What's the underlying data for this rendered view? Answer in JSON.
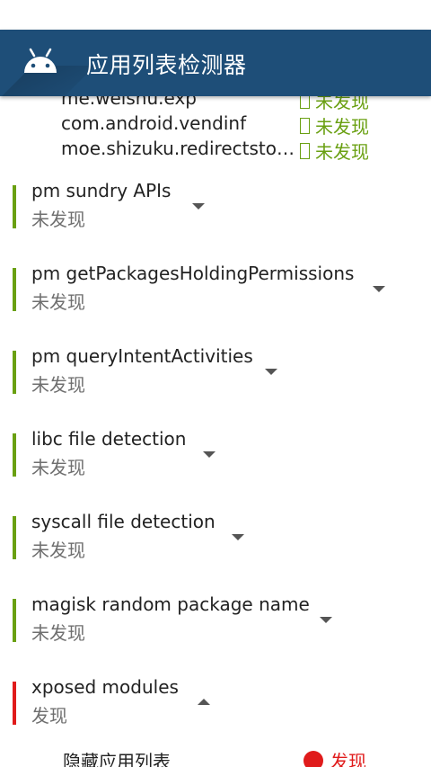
{
  "app": {
    "title": "应用列表检测器",
    "logo_icon": "android-icon",
    "colors": {
      "primary": "#1e4e78",
      "ok": "#6aa012",
      "bad": "#e01b1b"
    }
  },
  "packages": [
    {
      "name": "me.weishu.exp",
      "status": "未发现"
    },
    {
      "name": "com.android.vendinf",
      "status": "未发现"
    },
    {
      "name": "moe.shizuku.redirectstorage",
      "status": "未发现"
    }
  ],
  "checks": [
    {
      "name": "pm sundry APIs",
      "status": "未发现",
      "expanded": false
    },
    {
      "name": "pm getPackagesHoldingPermissions",
      "status": "未发现",
      "expanded": false
    },
    {
      "name": "pm queryIntentActivities",
      "status": "未发现",
      "expanded": false
    },
    {
      "name": "libc file detection",
      "status": "未发现",
      "expanded": false
    },
    {
      "name": "syscall file detection",
      "status": "未发现",
      "expanded": false
    },
    {
      "name": "magisk random package name",
      "status": "未发现",
      "expanded": false
    },
    {
      "name": "xposed modules",
      "status": "发现",
      "expanded": true
    }
  ],
  "xposed_detail": {
    "label": "隐藏应用列表",
    "status": "发现"
  }
}
